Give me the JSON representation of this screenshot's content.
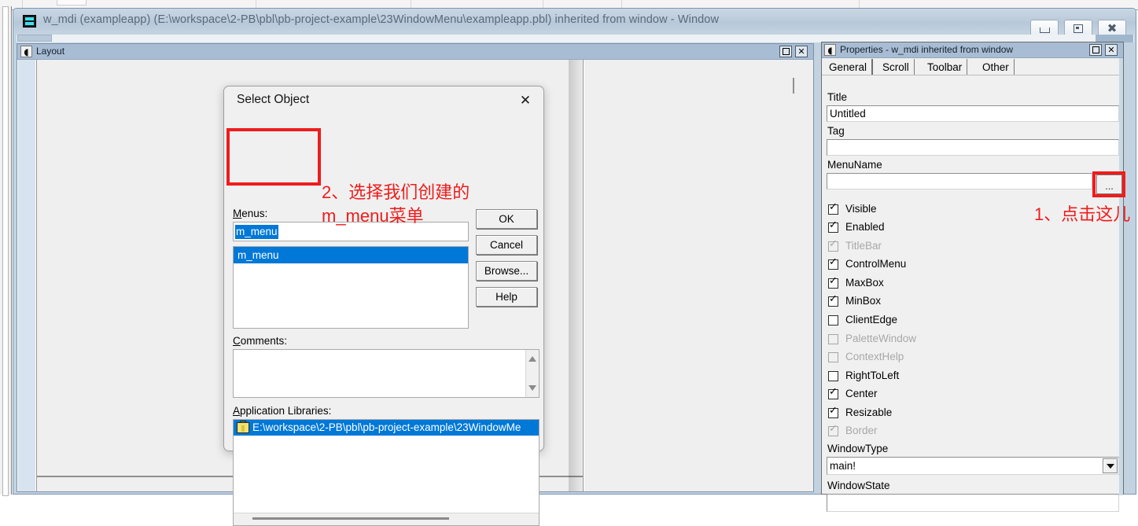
{
  "window": {
    "title": "w_mdi (exampleapp) (E:\\workspace\\2-PB\\pbl\\pb-project-example\\23WindowMenu\\exampleapp.pbl) inherited from window - Window",
    "icon": "window-object-icon",
    "minimize_label": "–",
    "maximize_label": "□",
    "close_label": "✕"
  },
  "layout_pane": {
    "title": "Layout",
    "icon": "layout-icon",
    "restore_label": "□",
    "close_label": "✕"
  },
  "dialog": {
    "title": "Select Object",
    "close_label": "✕",
    "menus_label": "Menus:",
    "menu_value": "m_menu",
    "menu_list": [
      "m_menu"
    ],
    "comments_label": "Comments:",
    "comments_value": "",
    "applibs_label": "Application Libraries:",
    "applibs_items": [
      "E:\\workspace\\2-PB\\pbl\\pb-project-example\\23WindowMe"
    ],
    "buttons": {
      "ok": "OK",
      "cancel": "Cancel",
      "browse": "Browse...",
      "help": "Help"
    }
  },
  "annotations": {
    "step1": "1、点击这儿",
    "step2": "2、选择我们创建的\nm_menu菜单",
    "color": "#ee1c1c"
  },
  "properties": {
    "title": "Properties - w_mdi inherited from window",
    "icon": "properties-icon",
    "restore_label": "□",
    "close_label": "✕",
    "tabs": [
      {
        "label": "General",
        "active": true
      },
      {
        "label": "Scroll",
        "active": false
      },
      {
        "label": "Toolbar",
        "active": false
      },
      {
        "label": "Other",
        "active": false
      }
    ],
    "fields": [
      {
        "label": "Title",
        "value": "Untitled"
      },
      {
        "label": "Tag",
        "value": ""
      },
      {
        "label": "MenuName",
        "value": ""
      }
    ],
    "ellipsis_button": "...",
    "checkboxes": [
      {
        "label": "Visible",
        "checked": true,
        "enabled": true
      },
      {
        "label": "Enabled",
        "checked": true,
        "enabled": true
      },
      {
        "label": "TitleBar",
        "checked": true,
        "enabled": false
      },
      {
        "label": "ControlMenu",
        "checked": true,
        "enabled": true
      },
      {
        "label": "MaxBox",
        "checked": true,
        "enabled": true
      },
      {
        "label": "MinBox",
        "checked": true,
        "enabled": true
      },
      {
        "label": "ClientEdge",
        "checked": false,
        "enabled": true
      },
      {
        "label": "PaletteWindow",
        "checked": false,
        "enabled": false
      },
      {
        "label": "ContextHelp",
        "checked": false,
        "enabled": false
      },
      {
        "label": "RightToLeft",
        "checked": false,
        "enabled": true
      },
      {
        "label": "Center",
        "checked": true,
        "enabled": true
      },
      {
        "label": "Resizable",
        "checked": true,
        "enabled": true
      },
      {
        "label": "Border",
        "checked": true,
        "enabled": false
      }
    ],
    "windowtype_label": "WindowType",
    "windowtype_value": "main!",
    "windowstate_label": "WindowState",
    "windowstate_value": ""
  },
  "colors": {
    "selection_blue": "#0078d7",
    "titlebar_blue": "#a8bdd3",
    "mdi_bg": "#c3d2e0",
    "panel_gray": "#f0f0f0",
    "annotation_red": "#ee1c1c"
  }
}
